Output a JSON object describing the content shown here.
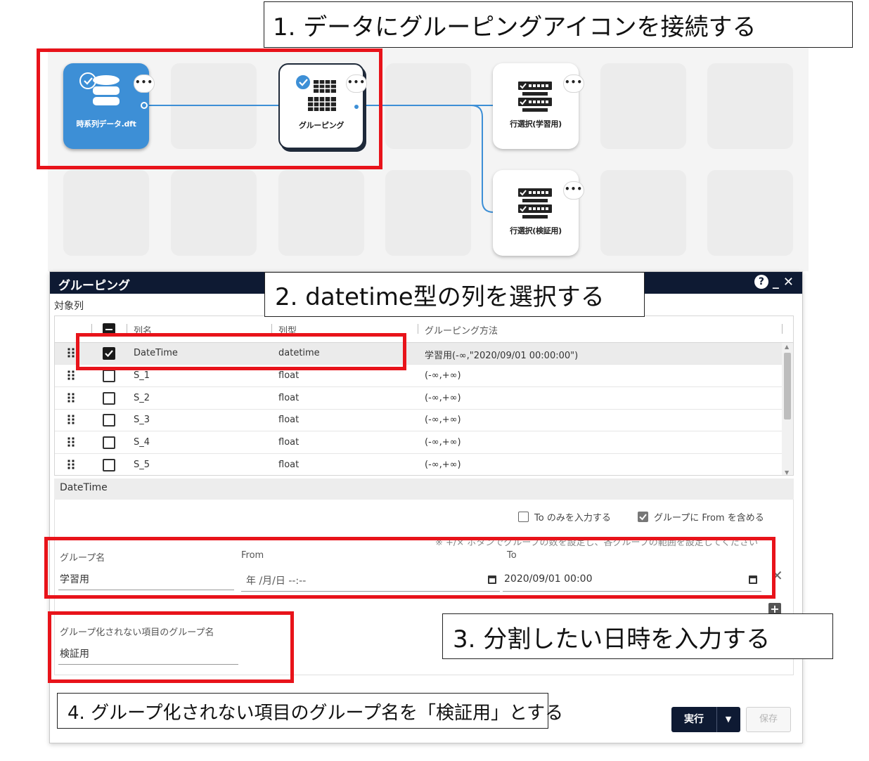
{
  "colors": {
    "accent": "#3d8fd6",
    "dialog_header": "#0e1a33",
    "annotation_red": "#e8131a",
    "canvas_bg": "#f4f4f4",
    "tile_bg": "#ececec"
  },
  "callouts": {
    "step1": "1. データにグルーピングアイコンを接続する",
    "step2": "2. datetime型の列を選択する",
    "step3": "3. 分割したい日時を入力する",
    "step4": "4. グループ化されない項目のグループ名を「検証用」とする"
  },
  "flow": {
    "nodes": {
      "dataset": {
        "label": "時系列データ.dft",
        "icon": "database-icon",
        "checked": true
      },
      "grouping": {
        "label": "グルーピング",
        "icon": "grid-table-icon",
        "checked": true
      },
      "row_select_train": {
        "label": "行選択(学習用)",
        "icon": "row-select-icon"
      },
      "row_select_valid": {
        "label": "行選択(検証用)",
        "icon": "row-select-icon"
      }
    },
    "menu_glyph": "•••"
  },
  "dialog": {
    "title": "グルーピング",
    "header_icons": {
      "help": "?",
      "minimize": "_",
      "close": "✕"
    },
    "target_label": "対象列",
    "table": {
      "headers": {
        "name": "列名",
        "type": "列型",
        "method": "グルーピング方法"
      },
      "rows": [
        {
          "checked": true,
          "name": "DateTime",
          "type": "datetime",
          "method": "学習用(-∞,\"2020/09/01 00:00:00\")"
        },
        {
          "checked": false,
          "name": "S_1",
          "type": "float",
          "method": "(-∞,+∞)"
        },
        {
          "checked": false,
          "name": "S_2",
          "type": "float",
          "method": "(-∞,+∞)"
        },
        {
          "checked": false,
          "name": "S_3",
          "type": "float",
          "method": "(-∞,+∞)"
        },
        {
          "checked": false,
          "name": "S_4",
          "type": "float",
          "method": "(-∞,+∞)"
        },
        {
          "checked": false,
          "name": "S_5",
          "type": "float",
          "method": "(-∞,+∞)"
        }
      ]
    },
    "detail": {
      "title": "DateTime",
      "option_to_only": {
        "label": "To のみを入力する",
        "checked": false
      },
      "option_include_from": {
        "label": "グループに From を含める",
        "checked": true
      },
      "note": "※ +/× ボタンでグループの数を設定し、各グループの範囲を設定してください",
      "group_name_label": "グループ名",
      "group_name_value": "学習用",
      "from_label": "From",
      "from_value": "年 /月/日 --:--",
      "to_label": "To",
      "to_value": "2020/09/01 00:00",
      "remove_glyph": "✕",
      "add_glyph": "+",
      "ungrouped_label": "グループ化されない項目のグループ名",
      "ungrouped_value": "検証用"
    },
    "buttons": {
      "run": "実行",
      "run_caret": "▼",
      "save": "保存"
    }
  }
}
